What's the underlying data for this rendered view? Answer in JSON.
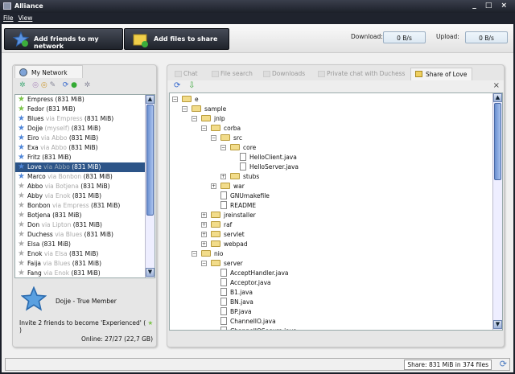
{
  "window": {
    "title": "Alliance",
    "controls": "_ □ ×"
  },
  "menu": [
    "File",
    "View"
  ],
  "toolbar": {
    "add_friends": "Add friends to my network",
    "add_files": "Add files to share",
    "download_label": "Download:",
    "download_value": "0 B/s",
    "upload_label": "Upload:",
    "upload_value": "0 B/s"
  },
  "network": {
    "tab": "My Network",
    "friends": [
      {
        "name": "Empress",
        "via": "",
        "size": "(831 MiB)",
        "star": "green"
      },
      {
        "name": "Fedor",
        "via": "",
        "size": "(831 MiB)",
        "star": "green"
      },
      {
        "name": "Blues",
        "via": "via Empress",
        "size": "(831 MiB)",
        "star": "blue"
      },
      {
        "name": "Dojje",
        "via": "(myself)",
        "size": "(831 MiB)",
        "star": "blue"
      },
      {
        "name": "Eiro",
        "via": "via Abbo",
        "size": "(831 MiB)",
        "star": "blue"
      },
      {
        "name": "Exa",
        "via": "via Abbo",
        "size": "(831 MiB)",
        "star": "blue"
      },
      {
        "name": "Fritz",
        "via": "",
        "size": "(831 MiB)",
        "star": "blue"
      },
      {
        "name": "Love",
        "via": "via Abbo",
        "size": "(831 MiB)",
        "star": "blue",
        "selected": true
      },
      {
        "name": "Marco",
        "via": "via Bonbon",
        "size": "(831 MiB)",
        "star": "blue"
      },
      {
        "name": "Abbo",
        "via": "via Botjena",
        "size": "(831 MiB)",
        "star": "gray"
      },
      {
        "name": "Abby",
        "via": "via Enok",
        "size": "(831 MiB)",
        "star": "gray"
      },
      {
        "name": "Bonbon",
        "via": "via Empress",
        "size": "(831 MiB)",
        "star": "gray"
      },
      {
        "name": "Botjena",
        "via": "",
        "size": "(831 MiB)",
        "star": "gray"
      },
      {
        "name": "Don",
        "via": "via Lipton",
        "size": "(831 MiB)",
        "star": "gray"
      },
      {
        "name": "Duchess",
        "via": "via Blues",
        "size": "(831 MiB)",
        "star": "gray"
      },
      {
        "name": "Elsa",
        "via": "",
        "size": "(831 MiB)",
        "star": "gray"
      },
      {
        "name": "Enok",
        "via": "via Elsa",
        "size": "(831 MiB)",
        "star": "gray"
      },
      {
        "name": "Faija",
        "via": "via Blues",
        "size": "(831 MiB)",
        "star": "gray"
      },
      {
        "name": "Fang",
        "via": "via Enok",
        "size": "(831 MiB)",
        "star": "gray"
      }
    ],
    "profile_name": "Dojje  -  True Member",
    "invite_text": "Invite 2 friends to become 'Experienced' (",
    "invite_end": ")",
    "online": "Online: 27/27 (22,7 GB)"
  },
  "tabs": [
    {
      "label": "Chat"
    },
    {
      "label": "File search"
    },
    {
      "label": "Downloads"
    },
    {
      "label": "Private chat with Duchess"
    },
    {
      "label": "Share of Love",
      "active": true
    }
  ],
  "close_label": "×",
  "tree": [
    {
      "label": "e",
      "level": 0,
      "type": "folder",
      "pm": "-"
    },
    {
      "label": "sample",
      "level": 1,
      "type": "folder",
      "pm": "-"
    },
    {
      "label": "jnlp",
      "level": 2,
      "type": "folder",
      "pm": "-"
    },
    {
      "label": "corba",
      "level": 3,
      "type": "folder",
      "pm": "-"
    },
    {
      "label": "src",
      "level": 4,
      "type": "folder",
      "pm": "-"
    },
    {
      "label": "core",
      "level": 5,
      "type": "folder",
      "pm": "-"
    },
    {
      "label": "HelloClient.java",
      "level": 6,
      "type": "file"
    },
    {
      "label": "HelloServer.java",
      "level": 6,
      "type": "file"
    },
    {
      "label": "stubs",
      "level": 5,
      "type": "folder",
      "pm": "+"
    },
    {
      "label": "war",
      "level": 4,
      "type": "folder",
      "pm": "+"
    },
    {
      "label": "GNUmakefile",
      "level": 4,
      "type": "file"
    },
    {
      "label": "README",
      "level": 4,
      "type": "file"
    },
    {
      "label": "jreinstaller",
      "level": 3,
      "type": "folder",
      "pm": "+"
    },
    {
      "label": "raf",
      "level": 3,
      "type": "folder",
      "pm": "+"
    },
    {
      "label": "servlet",
      "level": 3,
      "type": "folder",
      "pm": "+"
    },
    {
      "label": "webpad",
      "level": 3,
      "type": "folder",
      "pm": "+"
    },
    {
      "label": "nio",
      "level": 2,
      "type": "folder",
      "pm": "-"
    },
    {
      "label": "server",
      "level": 3,
      "type": "folder",
      "pm": "-"
    },
    {
      "label": "AcceptHandler.java",
      "level": 4,
      "type": "file"
    },
    {
      "label": "Acceptor.java",
      "level": 4,
      "type": "file"
    },
    {
      "label": "B1.java",
      "level": 4,
      "type": "file"
    },
    {
      "label": "BN.java",
      "level": 4,
      "type": "file"
    },
    {
      "label": "BP.java",
      "level": 4,
      "type": "file"
    },
    {
      "label": "ChannelIO.java",
      "level": 4,
      "type": "file"
    },
    {
      "label": "ChannelIOSecure.java",
      "level": 4,
      "type": "file"
    }
  ],
  "status": {
    "share": "Share: 831 MiB in 374 files"
  },
  "colors": {
    "green": "#7cc44a",
    "blue": "#4f86d8",
    "gray": "#a9a9a9",
    "selected": "#2c5488"
  }
}
